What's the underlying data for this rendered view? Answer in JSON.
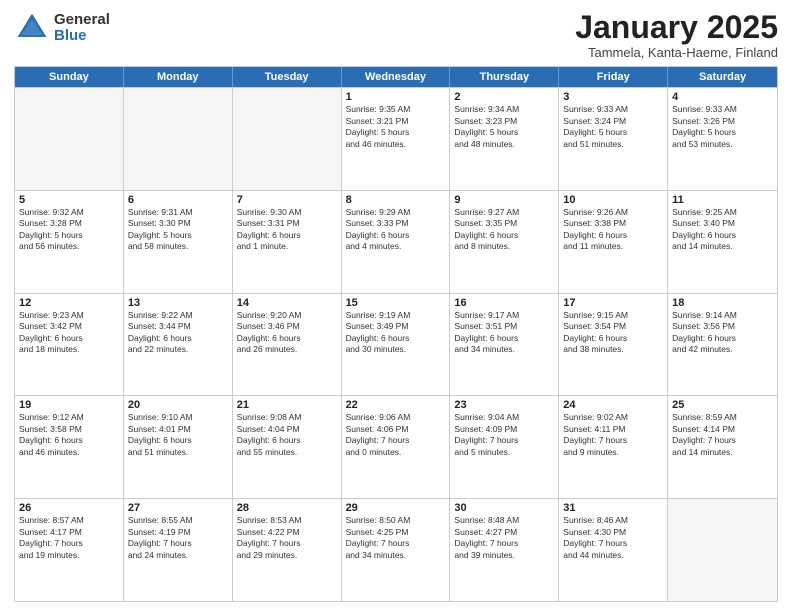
{
  "header": {
    "logo_general": "General",
    "logo_blue": "Blue",
    "month_title": "January 2025",
    "subtitle": "Tammela, Kanta-Haeme, Finland"
  },
  "weekdays": [
    "Sunday",
    "Monday",
    "Tuesday",
    "Wednesday",
    "Thursday",
    "Friday",
    "Saturday"
  ],
  "weeks": [
    [
      {
        "day": "",
        "info": ""
      },
      {
        "day": "",
        "info": ""
      },
      {
        "day": "",
        "info": ""
      },
      {
        "day": "1",
        "info": "Sunrise: 9:35 AM\nSunset: 3:21 PM\nDaylight: 5 hours\nand 46 minutes."
      },
      {
        "day": "2",
        "info": "Sunrise: 9:34 AM\nSunset: 3:23 PM\nDaylight: 5 hours\nand 48 minutes."
      },
      {
        "day": "3",
        "info": "Sunrise: 9:33 AM\nSunset: 3:24 PM\nDaylight: 5 hours\nand 51 minutes."
      },
      {
        "day": "4",
        "info": "Sunrise: 9:33 AM\nSunset: 3:26 PM\nDaylight: 5 hours\nand 53 minutes."
      }
    ],
    [
      {
        "day": "5",
        "info": "Sunrise: 9:32 AM\nSunset: 3:28 PM\nDaylight: 5 hours\nand 56 minutes."
      },
      {
        "day": "6",
        "info": "Sunrise: 9:31 AM\nSunset: 3:30 PM\nDaylight: 5 hours\nand 58 minutes."
      },
      {
        "day": "7",
        "info": "Sunrise: 9:30 AM\nSunset: 3:31 PM\nDaylight: 6 hours\nand 1 minute."
      },
      {
        "day": "8",
        "info": "Sunrise: 9:29 AM\nSunset: 3:33 PM\nDaylight: 6 hours\nand 4 minutes."
      },
      {
        "day": "9",
        "info": "Sunrise: 9:27 AM\nSunset: 3:35 PM\nDaylight: 6 hours\nand 8 minutes."
      },
      {
        "day": "10",
        "info": "Sunrise: 9:26 AM\nSunset: 3:38 PM\nDaylight: 6 hours\nand 11 minutes."
      },
      {
        "day": "11",
        "info": "Sunrise: 9:25 AM\nSunset: 3:40 PM\nDaylight: 6 hours\nand 14 minutes."
      }
    ],
    [
      {
        "day": "12",
        "info": "Sunrise: 9:23 AM\nSunset: 3:42 PM\nDaylight: 6 hours\nand 18 minutes."
      },
      {
        "day": "13",
        "info": "Sunrise: 9:22 AM\nSunset: 3:44 PM\nDaylight: 6 hours\nand 22 minutes."
      },
      {
        "day": "14",
        "info": "Sunrise: 9:20 AM\nSunset: 3:46 PM\nDaylight: 6 hours\nand 26 minutes."
      },
      {
        "day": "15",
        "info": "Sunrise: 9:19 AM\nSunset: 3:49 PM\nDaylight: 6 hours\nand 30 minutes."
      },
      {
        "day": "16",
        "info": "Sunrise: 9:17 AM\nSunset: 3:51 PM\nDaylight: 6 hours\nand 34 minutes."
      },
      {
        "day": "17",
        "info": "Sunrise: 9:15 AM\nSunset: 3:54 PM\nDaylight: 6 hours\nand 38 minutes."
      },
      {
        "day": "18",
        "info": "Sunrise: 9:14 AM\nSunset: 3:56 PM\nDaylight: 6 hours\nand 42 minutes."
      }
    ],
    [
      {
        "day": "19",
        "info": "Sunrise: 9:12 AM\nSunset: 3:58 PM\nDaylight: 6 hours\nand 46 minutes."
      },
      {
        "day": "20",
        "info": "Sunrise: 9:10 AM\nSunset: 4:01 PM\nDaylight: 6 hours\nand 51 minutes."
      },
      {
        "day": "21",
        "info": "Sunrise: 9:08 AM\nSunset: 4:04 PM\nDaylight: 6 hours\nand 55 minutes."
      },
      {
        "day": "22",
        "info": "Sunrise: 9:06 AM\nSunset: 4:06 PM\nDaylight: 7 hours\nand 0 minutes."
      },
      {
        "day": "23",
        "info": "Sunrise: 9:04 AM\nSunset: 4:09 PM\nDaylight: 7 hours\nand 5 minutes."
      },
      {
        "day": "24",
        "info": "Sunrise: 9:02 AM\nSunset: 4:11 PM\nDaylight: 7 hours\nand 9 minutes."
      },
      {
        "day": "25",
        "info": "Sunrise: 8:59 AM\nSunset: 4:14 PM\nDaylight: 7 hours\nand 14 minutes."
      }
    ],
    [
      {
        "day": "26",
        "info": "Sunrise: 8:57 AM\nSunset: 4:17 PM\nDaylight: 7 hours\nand 19 minutes."
      },
      {
        "day": "27",
        "info": "Sunrise: 8:55 AM\nSunset: 4:19 PM\nDaylight: 7 hours\nand 24 minutes."
      },
      {
        "day": "28",
        "info": "Sunrise: 8:53 AM\nSunset: 4:22 PM\nDaylight: 7 hours\nand 29 minutes."
      },
      {
        "day": "29",
        "info": "Sunrise: 8:50 AM\nSunset: 4:25 PM\nDaylight: 7 hours\nand 34 minutes."
      },
      {
        "day": "30",
        "info": "Sunrise: 8:48 AM\nSunset: 4:27 PM\nDaylight: 7 hours\nand 39 minutes."
      },
      {
        "day": "31",
        "info": "Sunrise: 8:46 AM\nSunset: 4:30 PM\nDaylight: 7 hours\nand 44 minutes."
      },
      {
        "day": "",
        "info": ""
      }
    ]
  ]
}
